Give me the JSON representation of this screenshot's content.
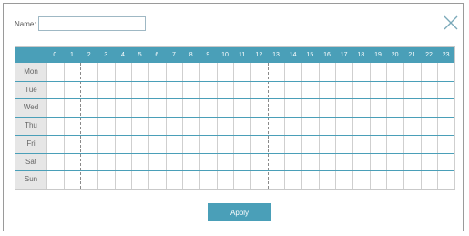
{
  "name_field": {
    "label": "Name:",
    "value": ""
  },
  "hours": [
    "0",
    "1",
    "2",
    "3",
    "4",
    "5",
    "6",
    "7",
    "8",
    "9",
    "10",
    "11",
    "12",
    "13",
    "14",
    "15",
    "16",
    "17",
    "18",
    "19",
    "20",
    "21",
    "22",
    "23"
  ],
  "days": [
    "Mon",
    "Tue",
    "Wed",
    "Thu",
    "Fri",
    "Sat",
    "Sun"
  ],
  "apply_label": "Apply",
  "colors": {
    "accent": "#4a9fb8",
    "day_column_bg": "#e6e6e6",
    "border": "#9a9a9a"
  }
}
